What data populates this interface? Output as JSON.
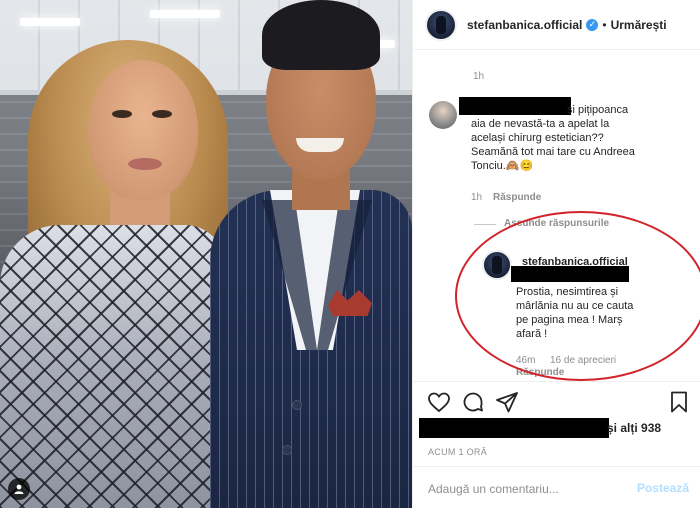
{
  "post": {
    "username": "stefanbanica.official",
    "verified_badge": "✓",
    "separator": "•",
    "follow_status": "Urmărești"
  },
  "comments": {
    "prev_time": "1h",
    "comment1": {
      "text_line1": "și pițipoanca",
      "text_line2": "aia de nevastă-ta a apelat la",
      "text_line3": "același chirurg estetician??",
      "text_line4": "Seamănă tot mai tare cu Andreea",
      "text_line5": "Tonciu.🙈😊",
      "time": "1h",
      "reply": "Răspunde"
    },
    "hide_replies": "Ascunde răspunsurile",
    "reply": {
      "username": "stefanbanica.official",
      "text_line1": "Prostia, nesimtirea și",
      "text_line2": "mârlănia nu au ce cauta",
      "text_line3": "pe pagina mea ! Marș",
      "text_line4": "afară !",
      "time": "46m",
      "likes": "16 de aprecieri",
      "reply": "Răspunde"
    }
  },
  "likes": {
    "suffix": "și alți 938"
  },
  "timestamp": "ACUM 1 ORĂ",
  "add_comment": {
    "placeholder": "Adaugă un comentariu...",
    "post_label": "Postează"
  },
  "icons": [
    "heart-icon",
    "comment-icon",
    "share-icon",
    "bookmark-icon",
    "user-tag-icon",
    "verified-icon"
  ],
  "colors": {
    "accent": "#3897f0",
    "post_disabled": "#b2dffc",
    "annotation": "#d2232a",
    "muted": "#8e8e8e"
  }
}
